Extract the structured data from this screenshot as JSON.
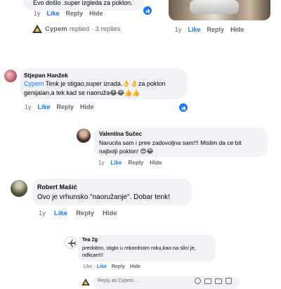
{
  "thread": {
    "top_comment": {
      "text_tail": "Evo došlo .super izgleda za poklon.",
      "meta": {
        "time": "1y",
        "like": "Like",
        "reply": "Reply",
        "hide": "Hide"
      }
    },
    "photo_meta": {
      "time": "1y",
      "like": "Like",
      "reply": "Reply",
      "hide": "Hide"
    },
    "replies_summary": {
      "author": "Cypem",
      "text": "replied · 3 replies"
    },
    "comments": [
      {
        "author": "Stjepan Hanžek",
        "mention": "Cypem",
        "text_line1": "Tenk je stigao,super izrada.👌👌za poklon",
        "text_line2": "genijalan,a tek kad se naoruža😂😂👍👍",
        "meta": {
          "time": "1y",
          "like": "Like",
          "reply": "Reply",
          "hide": "Hide"
        }
      },
      {
        "author": "Valentina Sučec",
        "text_line1": "Narucila sam i pree zadovoljna sam!!! Mislim da ce bit",
        "text_line2": "najbolji poklon! 😍😂",
        "meta": {
          "time": "1y",
          "like": "Like",
          "reply": "Reply",
          "hide": "Hide"
        }
      },
      {
        "author": "Robert Mašić",
        "text_line1": "Ovo je vrhunsko \"naoružanje\". Dobar tenk!",
        "meta": {
          "time": "1y",
          "like": "Like",
          "reply": "Reply",
          "hide": "Hide"
        }
      },
      {
        "author": "Tea Zg",
        "text_line1": "predobro, stiglo u rekordnom roku,kao na slici je,",
        "text_line2": "odlican!!!",
        "meta": {
          "time": "13w",
          "like": "Like",
          "reply": "Reply",
          "hide": "Hide"
        }
      }
    ],
    "bottom_reply_preview": {
      "text": "Reply as Cypem..."
    }
  },
  "colors": {
    "link": "#1877f2",
    "bubble": "#f0f2f5",
    "meta": "#65676b"
  },
  "icons": [
    "like-reaction-icon",
    "reply-arrow-icon",
    "cypem-avatar-icon",
    "emoji-icon",
    "camera-icon",
    "gif-icon",
    "sticker-icon"
  ]
}
